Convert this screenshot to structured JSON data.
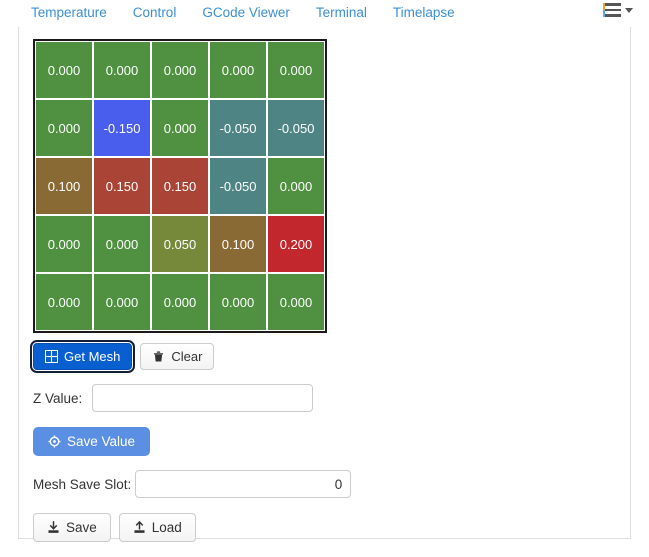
{
  "tabs": [
    {
      "label": "Temperature",
      "name": "tab-temperature"
    },
    {
      "label": "Control",
      "name": "tab-control"
    },
    {
      "label": "GCode Viewer",
      "name": "tab-gcode-viewer"
    },
    {
      "label": "Terminal",
      "name": "tab-terminal"
    },
    {
      "label": "Timelapse",
      "name": "tab-timelapse"
    }
  ],
  "menu": {
    "hamburger_icon": "hamburger-menu-icon",
    "caret_icon": "chevron-down-icon"
  },
  "mesh": {
    "rows": 5,
    "cols": 5,
    "values": [
      [
        "0.000",
        "0.000",
        "0.000",
        "0.000",
        "0.000"
      ],
      [
        "0.000",
        "-0.150",
        "0.000",
        "-0.050",
        "-0.050"
      ],
      [
        "0.100",
        "0.150",
        "0.150",
        "-0.050",
        "0.000"
      ],
      [
        "0.000",
        "0.000",
        "0.050",
        "0.100",
        "0.200"
      ],
      [
        "0.000",
        "0.000",
        "0.000",
        "0.000",
        "0.000"
      ]
    ],
    "colors": [
      [
        "#4f9140",
        "#4f9140",
        "#4f9140",
        "#4f9140",
        "#4f9140"
      ],
      [
        "#4f9140",
        "#4a5eee",
        "#4f9140",
        "#4f8484",
        "#4f8484"
      ],
      [
        "#8a6a34",
        "#a94436",
        "#a94436",
        "#4f8484",
        "#4f9140"
      ],
      [
        "#4f9140",
        "#4f9140",
        "#76893a",
        "#8a6a34",
        "#c1272d"
      ],
      [
        "#4f9140",
        "#4f9140",
        "#4f9140",
        "#4f9140",
        "#4f9140"
      ]
    ],
    "border_color": "#1b1b1b"
  },
  "controls": {
    "get_mesh": {
      "label": "Get Mesh",
      "icon": "grid-icon"
    },
    "clear": {
      "label": "Clear",
      "icon": "trash-icon"
    },
    "z_value": {
      "label": "Z Value:",
      "value": "",
      "placeholder": ""
    },
    "save_value": {
      "label": "Save Value",
      "icon": "crosshair-icon"
    },
    "mesh_save_slot": {
      "label": "Mesh Save Slot:",
      "value": "0",
      "placeholder": ""
    },
    "save": {
      "label": "Save",
      "icon": "download-icon"
    },
    "load": {
      "label": "Load",
      "icon": "upload-icon"
    }
  },
  "theme": {
    "tab_link_color": "#3b8fd4",
    "primary_button_color": "#0a5fd0",
    "save_value_button_color": "#5b8fe3"
  }
}
